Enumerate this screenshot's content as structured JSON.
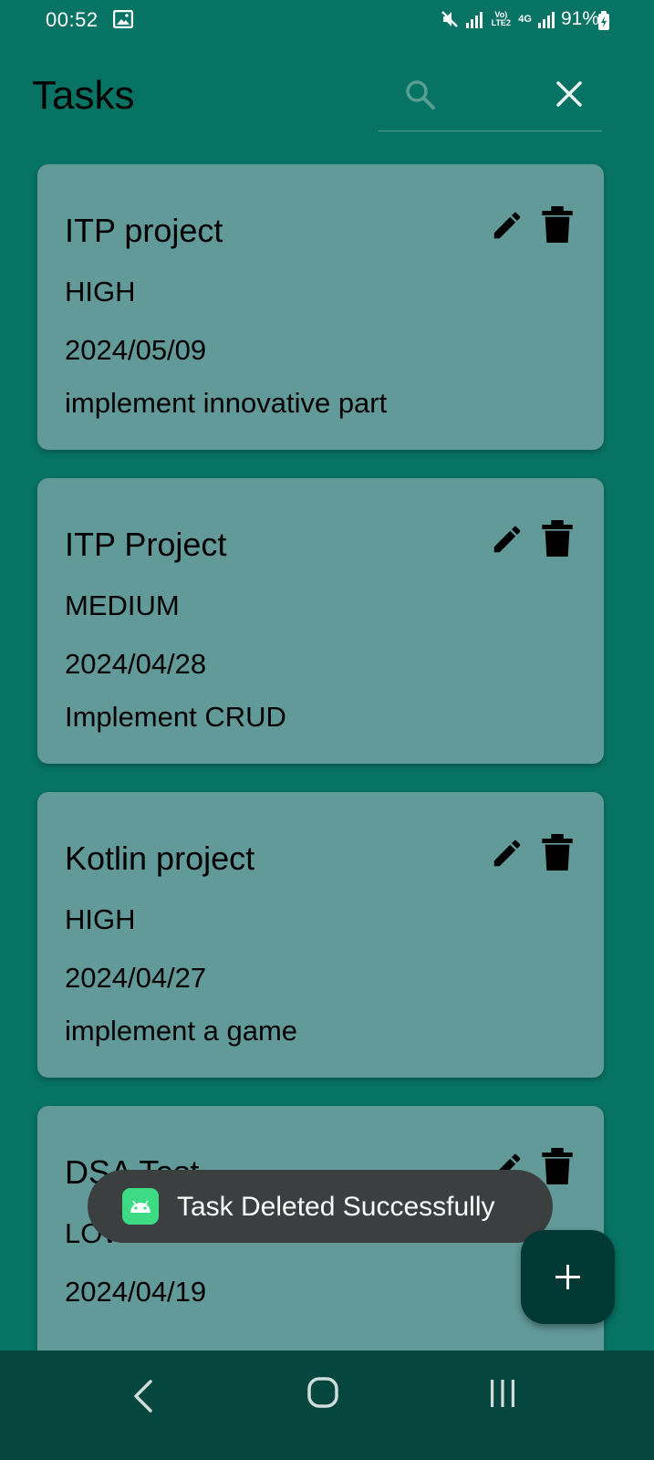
{
  "status_bar": {
    "time": "00:52",
    "signal_label": "Vo) LTE2",
    "network": "4G",
    "battery": "91%"
  },
  "header": {
    "title": "Tasks"
  },
  "tasks": [
    {
      "title": "ITP project",
      "priority": "HIGH",
      "date": "2024/05/09",
      "description": "implement innovative part"
    },
    {
      "title": "ITP Project",
      "priority": "MEDIUM",
      "date": "2024/04/28",
      "description": "Implement CRUD"
    },
    {
      "title": "Kotlin project",
      "priority": "HIGH",
      "date": "2024/04/27",
      "description": "implement a game"
    },
    {
      "title": "DSA Test",
      "priority": "LOW",
      "date": "2024/04/19",
      "description": ""
    }
  ],
  "toast": {
    "message": "Task Deleted Successfully"
  },
  "fab": {
    "icon": "plus-icon"
  },
  "colors": {
    "background": "#077364",
    "card": "#629999",
    "fab": "#003833",
    "nav_bar": "#05463e",
    "toast": "#3c3f40"
  }
}
